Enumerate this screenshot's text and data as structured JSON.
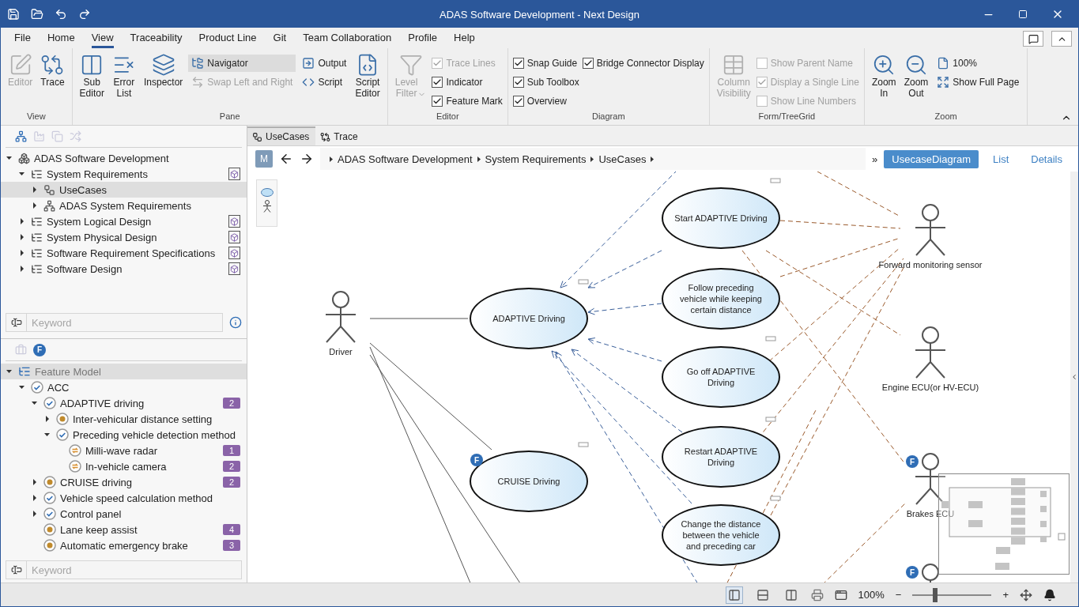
{
  "window": {
    "title": "ADAS Software Development - Next Design"
  },
  "menu": [
    {
      "label": "File",
      "selected": false
    },
    {
      "label": "Home",
      "selected": false
    },
    {
      "label": "View",
      "selected": true
    },
    {
      "label": "Traceability",
      "selected": false
    },
    {
      "label": "Product Line",
      "selected": false
    },
    {
      "label": "Git",
      "selected": false
    },
    {
      "label": "Team Collaboration",
      "selected": false
    },
    {
      "label": "Profile",
      "selected": false
    },
    {
      "label": "Help",
      "selected": false
    }
  ],
  "ribbon": [
    {
      "label": "View",
      "columns": [
        [
          {
            "kind": "large",
            "label": "Editor",
            "disabled": true
          }
        ],
        [
          {
            "kind": "large",
            "label": "Trace",
            "disabled": false
          }
        ]
      ]
    },
    {
      "label": "Pane",
      "columns": [
        [
          {
            "kind": "large",
            "label": "Sub Editor",
            "disabled": false
          }
        ],
        [
          {
            "kind": "large",
            "label": "Error List",
            "disabled": false
          }
        ],
        [
          {
            "kind": "large",
            "label": "Inspector",
            "disabled": false
          }
        ],
        [
          {
            "kind": "small",
            "label": "Navigator",
            "disabled": false,
            "selected": true
          },
          {
            "kind": "small",
            "label": "Swap Left and Right",
            "disabled": true,
            "selected": false
          }
        ],
        [
          {
            "kind": "small",
            "label": "Output",
            "disabled": false,
            "selected": false
          },
          {
            "kind": "small",
            "label": "Script",
            "disabled": false,
            "selected": false
          }
        ],
        [
          {
            "kind": "large",
            "label": "Script Editor",
            "disabled": false
          }
        ]
      ]
    },
    {
      "label": "Editor",
      "columns": [
        [
          {
            "kind": "dropdown",
            "label": "Level Filter",
            "disabled": true
          }
        ],
        [
          {
            "kind": "check",
            "label": "Trace Lines",
            "checked": true,
            "disabled": true
          },
          {
            "kind": "check",
            "label": "Indicator",
            "checked": true,
            "disabled": false
          },
          {
            "kind": "check",
            "label": "Feature Mark",
            "checked": true,
            "disabled": false
          }
        ]
      ]
    },
    {
      "label": "Diagram",
      "columns": [
        [
          {
            "kind": "check",
            "label": "Snap Guide",
            "checked": true,
            "disabled": false
          },
          {
            "kind": "check",
            "label": "Sub Toolbox",
            "checked": true,
            "disabled": false
          },
          {
            "kind": "check",
            "label": "Overview",
            "checked": true,
            "disabled": false
          }
        ],
        [
          {
            "kind": "check",
            "label": "Bridge Connector Display",
            "checked": true,
            "disabled": false
          }
        ]
      ]
    },
    {
      "label": "Form/TreeGrid",
      "columns": [
        [
          {
            "kind": "large",
            "label": "Column Visibility",
            "disabled": true
          }
        ],
        [
          {
            "kind": "check",
            "label": "Show Parent Name",
            "checked": false,
            "disabled": true
          },
          {
            "kind": "check",
            "label": "Display a Single Line",
            "checked": true,
            "disabled": true
          },
          {
            "kind": "check",
            "label": "Show Line Numbers",
            "checked": false,
            "disabled": true
          }
        ]
      ]
    },
    {
      "label": "Zoom",
      "columns": [
        [
          {
            "kind": "large",
            "label": "Zoom In",
            "disabled": false
          }
        ],
        [
          {
            "kind": "large",
            "label": "Zoom Out",
            "disabled": false
          }
        ],
        [
          {
            "kind": "small",
            "label": "100%",
            "disabled": false,
            "selected": false
          },
          {
            "kind": "small",
            "label": "Show Full Page",
            "disabled": false,
            "selected": false
          }
        ]
      ]
    }
  ],
  "model_tree": {
    "items": [
      {
        "label": "ADAS Software Development",
        "kind": "project",
        "expanded": true,
        "selected": false,
        "linked": false,
        "children": [
          {
            "label": "System Requirements",
            "kind": "package",
            "expanded": true,
            "selected": false,
            "linked": true,
            "children": [
              {
                "label": "UseCases",
                "kind": "usecase",
                "expanded": false,
                "selected": true,
                "linked": false
              },
              {
                "label": "ADAS System Requirements",
                "kind": "hierarchy",
                "expanded": false,
                "selected": false,
                "linked": false
              }
            ]
          },
          {
            "label": "System Logical Design",
            "kind": "package",
            "expanded": false,
            "selected": false,
            "linked": true
          },
          {
            "label": "System Physical Design",
            "kind": "package",
            "expanded": false,
            "selected": false,
            "linked": true
          },
          {
            "label": "Software Requirement Specifications",
            "kind": "package",
            "expanded": false,
            "selected": false,
            "linked": true
          },
          {
            "label": "Software Design",
            "kind": "package",
            "expanded": false,
            "selected": false,
            "linked": true
          }
        ]
      }
    ],
    "search": {
      "placeholder": "Keyword"
    }
  },
  "feature_panel": {
    "feature_button": "F",
    "items": [
      {
        "label": "Feature Model",
        "kind": "root",
        "expanded": true,
        "selected": true,
        "children": [
          {
            "label": "ACC",
            "kind": "mandatory",
            "expanded": true,
            "selected": false,
            "children": [
              {
                "label": "ADAPTIVE driving",
                "kind": "mandatory",
                "expanded": true,
                "selected": false,
                "count": "2",
                "children": [
                  {
                    "label": "Inter-vehicular distance setting",
                    "kind": "optional",
                    "expanded": false,
                    "selected": false
                  },
                  {
                    "label": "Preceding vehicle detection method",
                    "kind": "mandatory",
                    "expanded": true,
                    "selected": false,
                    "children": [
                      {
                        "label": "Milli-wave radar",
                        "kind": "alternative",
                        "selected": false,
                        "count": "1"
                      },
                      {
                        "label": "In-vehicle camera",
                        "kind": "alternative",
                        "selected": false,
                        "count": "2"
                      }
                    ]
                  }
                ]
              },
              {
                "label": "CRUISE driving",
                "kind": "optional",
                "expanded": false,
                "selected": false,
                "count": "2"
              },
              {
                "label": "Vehicle speed calculation method",
                "kind": "mandatory",
                "expanded": false,
                "selected": false
              },
              {
                "label": "Control panel",
                "kind": "mandatory",
                "expanded": false,
                "selected": false
              },
              {
                "label": "Lane keep assist",
                "kind": "optional",
                "selected": false,
                "count": "4"
              },
              {
                "label": "Automatic emergency brake",
                "kind": "optional",
                "selected": false,
                "count": "3"
              }
            ]
          }
        ]
      }
    ],
    "search": {
      "placeholder": "Keyword"
    }
  },
  "doc_tabs": [
    {
      "label": "UseCases",
      "selected": true
    },
    {
      "label": "Trace",
      "selected": false
    }
  ],
  "breadcrumb": {
    "mode_button": "M",
    "path": [
      "ADAS Software Development",
      "System Requirements",
      "UseCases"
    ],
    "more": "»",
    "views": [
      {
        "label": "UsecaseDiagram",
        "selected": true
      },
      {
        "label": "List",
        "selected": false
      },
      {
        "label": "Details",
        "selected": false
      }
    ]
  },
  "diagram": {
    "use_cases": [
      {
        "label": "Start ADAPTIVE Driving"
      },
      {
        "label": "Follow preceding vehicle while keeping certain distance"
      },
      {
        "label": "ADAPTIVE Driving"
      },
      {
        "label": "Go off ADAPTIVE Driving"
      },
      {
        "label": "Restart ADAPTIVE Driving"
      },
      {
        "label": "CRUISE Driving",
        "badge": "F"
      },
      {
        "label": "Change the distance between the vehicle and preceding car"
      }
    ],
    "actors": [
      {
        "label": "Driver"
      },
      {
        "label": "Forward monitoring sensor"
      },
      {
        "label": "Engine ECU(or HV-ECU)"
      },
      {
        "label": "Brakes ECU",
        "badge": "F"
      },
      {
        "badge": "F"
      }
    ]
  },
  "status_bar": {
    "layouts": [
      {
        "selected": true
      },
      {
        "selected": false
      },
      {
        "selected": false
      }
    ],
    "zoom": "100%",
    "zoom_out": "−",
    "zoom_in": "+",
    "zoom_slider": {
      "level": 0.26
    }
  }
}
